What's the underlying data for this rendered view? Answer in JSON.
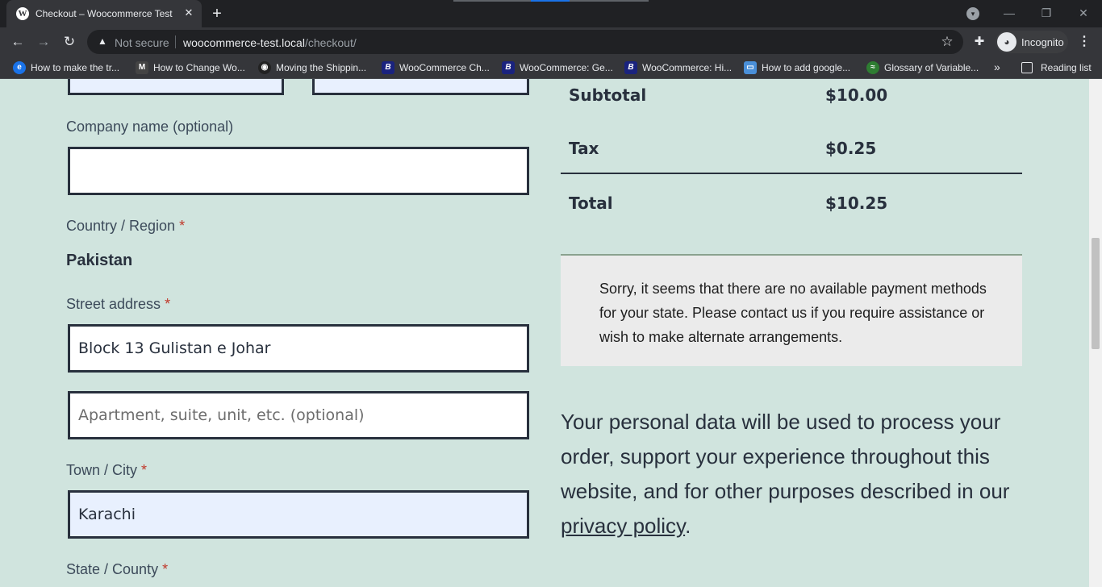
{
  "browser": {
    "tab_title": "Checkout – Woocommerce Test",
    "tab_favicon": "W",
    "new_tab_glyph": "+",
    "close_glyph": "✕",
    "not_secure": "Not secure",
    "url_host": "woocommerce-test.local",
    "url_path": "/checkout/",
    "incognito_label": "Incognito",
    "bookmarks": [
      {
        "label": "How to make the tr...",
        "icon": "e",
        "color": "#1a73e8"
      },
      {
        "label": "How to Change Wo...",
        "icon": "M",
        "color": "#444444"
      },
      {
        "label": "Moving the Shippin...",
        "icon": "◉",
        "color": "#222222"
      },
      {
        "label": "WooCommerce Ch...",
        "icon": "B",
        "color": "#1a237e"
      },
      {
        "label": "WooCommerce: Ge...",
        "icon": "B",
        "color": "#1a237e"
      },
      {
        "label": "WooCommerce: Hi...",
        "icon": "B",
        "color": "#1a237e"
      },
      {
        "label": "How to add google...",
        "icon": "▭",
        "color": "#4a90d9"
      },
      {
        "label": "Glossary of Variable...",
        "icon": "≈",
        "color": "#2e7d32"
      }
    ],
    "bookmarks_more": "»",
    "reading_list": "Reading list"
  },
  "form": {
    "company_label": "Company name (optional)",
    "company_value": "",
    "country_label": "Country / Region",
    "country_value": "Pakistan",
    "street_label": "Street address",
    "street_value": "Block 13 Gulistan e Johar",
    "apartment_placeholder": "Apartment, suite, unit, etc. (optional)",
    "city_label": "Town / City",
    "city_value": "Karachi",
    "state_label": "State / County",
    "required_mark": "*"
  },
  "order": {
    "subtotal_label": "Subtotal",
    "subtotal_value": "$10.00",
    "tax_label": "Tax",
    "tax_value": "$0.25",
    "total_label": "Total",
    "total_value": "$10.25"
  },
  "payment": {
    "notice": "Sorry, it seems that there are no available payment methods for your state. Please contact us if you require assistance or wish to make alternate arrangements."
  },
  "privacy": {
    "text": "Your personal data will be used to process your order, support your experience throughout this website, and for other purposes described in our ",
    "link": "privacy policy",
    "end": "."
  }
}
